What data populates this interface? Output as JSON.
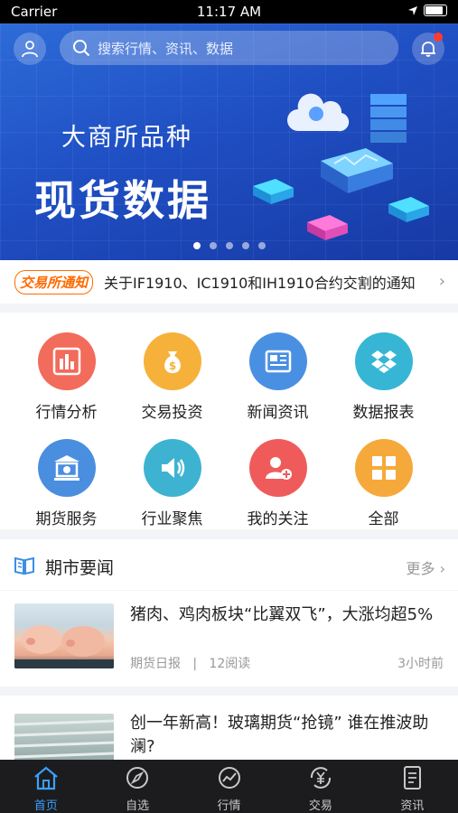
{
  "status": {
    "carrier": "Carrier",
    "time": "11:17 AM"
  },
  "header": {
    "search_placeholder": "搜索行情、资讯、数据"
  },
  "banner": {
    "subtitle": "大商所品种",
    "title": "现货数据",
    "dots": 5,
    "active_dot": 0
  },
  "notice": {
    "logo": "交易所通知",
    "text": "关于IF1910、IC1910和IH1910合约交割的通知"
  },
  "menu": [
    {
      "label": "行情分析",
      "color": "#f26b5b",
      "icon": "bar-chart-icon"
    },
    {
      "label": "交易投资",
      "color": "#f6b13b",
      "icon": "money-bag-icon"
    },
    {
      "label": "新闻资讯",
      "color": "#4a90e2",
      "icon": "newspaper-icon"
    },
    {
      "label": "数据报表",
      "color": "#36b6d4",
      "icon": "dropbox-icon"
    },
    {
      "label": "期货服务",
      "color": "#4a8ee0",
      "icon": "bank-icon"
    },
    {
      "label": "行业聚焦",
      "color": "#3db3d1",
      "icon": "speaker-icon"
    },
    {
      "label": "我的关注",
      "color": "#ef5b5b",
      "icon": "add-user-icon"
    },
    {
      "label": "全部",
      "color": "#f6a93b",
      "icon": "grid-icon"
    }
  ],
  "news_section": {
    "title": "期市要闻",
    "more": "更多"
  },
  "news": [
    {
      "title": "猪肉、鸡肉板块“比翼双飞”，大涨均超5%",
      "source": "期货日报",
      "reads": "12阅读",
      "time": "3小时前"
    },
    {
      "title": "创一年新高！玻璃期货“抢镜” 谁在推波助澜?",
      "source": "",
      "reads": "",
      "time": ""
    }
  ],
  "tabs": [
    {
      "label": "首页",
      "icon": "home-icon",
      "active": true
    },
    {
      "label": "自选",
      "icon": "compass-icon",
      "active": false
    },
    {
      "label": "行情",
      "icon": "trend-icon",
      "active": false
    },
    {
      "label": "交易",
      "icon": "yen-exchange-icon",
      "active": false
    },
    {
      "label": "资讯",
      "icon": "document-icon",
      "active": false
    }
  ],
  "colors": {
    "accent": "#3aa0ff",
    "banner": "#1f4fc3"
  }
}
